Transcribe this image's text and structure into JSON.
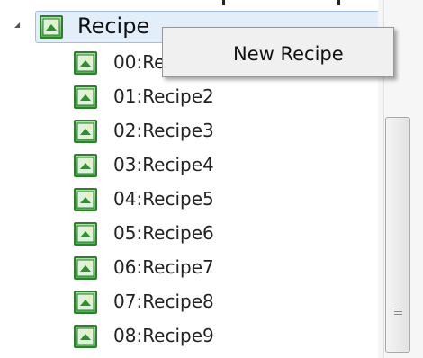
{
  "tree": {
    "root": {
      "label": "Recipe",
      "expanded": true,
      "icon": "recipe-node-icon"
    },
    "children": [
      {
        "label": "00:Re"
      },
      {
        "label": "01:Recipe2"
      },
      {
        "label": "02:Recipe3"
      },
      {
        "label": "03:Recipe4"
      },
      {
        "label": "04:Recipe5"
      },
      {
        "label": "05:Recipe6"
      },
      {
        "label": "06:Recipe7"
      },
      {
        "label": "07:Recipe8"
      },
      {
        "label": "08:Recipe9"
      }
    ]
  },
  "context_menu": {
    "items": [
      {
        "label": "New Recipe"
      }
    ]
  },
  "colors": {
    "selection_fill": "#e3eefb",
    "selection_border": "#9fbfe6",
    "menu_background": "#f0f0f0",
    "icon_green": "#52b252"
  }
}
